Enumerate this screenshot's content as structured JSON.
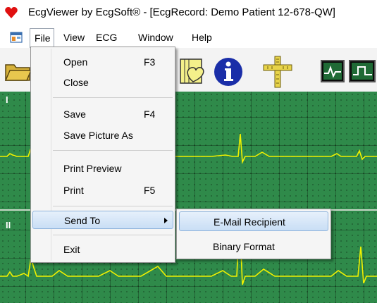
{
  "window": {
    "title": "EcgViewer by EcgSoft® - [EcgRecord: Demo Patient 12-678-QW]"
  },
  "menubar": {
    "items": [
      "File",
      "View",
      "ECG",
      "Window",
      "Help"
    ],
    "active": "File"
  },
  "toolbar": {
    "icons": [
      "open-folder-icon",
      "heart-document-icon",
      "info-icon",
      "ruler-caliper-icon",
      "ecg-wave-icon",
      "square-wave-icon"
    ]
  },
  "file_menu": {
    "open": {
      "label": "Open",
      "shortcut": "F3"
    },
    "close": {
      "label": "Close"
    },
    "save": {
      "label": "Save",
      "shortcut": "F4"
    },
    "save_picture": {
      "label": "Save Picture As"
    },
    "print_preview": {
      "label": "Print Preview"
    },
    "print": {
      "label": "Print",
      "shortcut": "F5"
    },
    "send_to": {
      "label": "Send To"
    },
    "exit": {
      "label": "Exit"
    }
  },
  "send_to_menu": {
    "email": {
      "label": "E-Mail Recipient"
    },
    "binary": {
      "label": "Binary Format"
    }
  },
  "ecg": {
    "leads": [
      "I",
      "II"
    ],
    "background_color": "#2f8a4a",
    "trace_color": "#f2f200"
  },
  "colors": {
    "heart": "#e01010",
    "menu_highlight": "#c9def5"
  }
}
